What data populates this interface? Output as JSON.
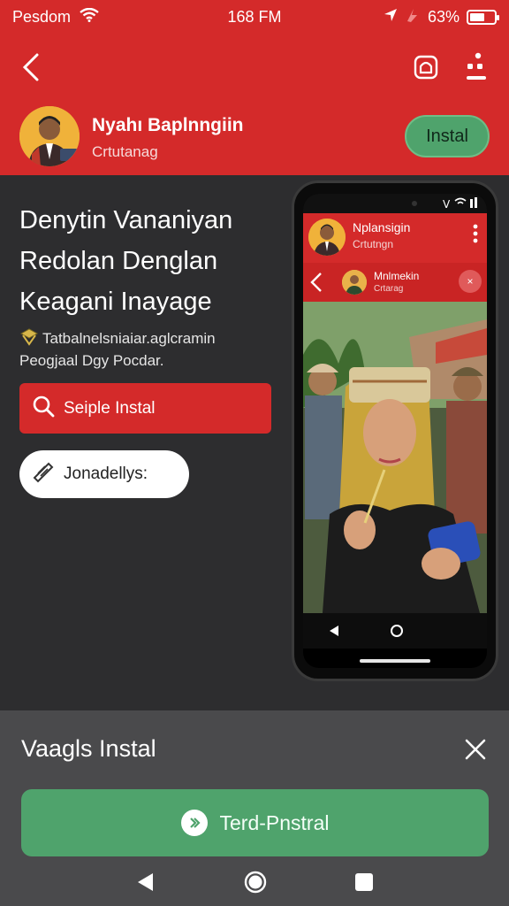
{
  "status_bar": {
    "carrier": "Pesdom",
    "time": "168 FM",
    "battery": "63%",
    "battery_level": 0.63
  },
  "header": {
    "app_name": "Nyahı Baplnngiin",
    "app_subtitle": "Crtutanag",
    "install_label": "Instal"
  },
  "headline": {
    "line1": "Denytin Vananiyan",
    "line2": "Redolan Denglan",
    "line3": "Keagani Inayage"
  },
  "promo": {
    "line1": "Tatbalnelsniaiar.aglcramin",
    "line2": "Peogjaal Dɡy Pocdar."
  },
  "search_button": {
    "label": "Seiple Instal"
  },
  "tag_button": {
    "label": "Jonadellys:"
  },
  "phone_preview": {
    "app_name": "Nplansigin",
    "app_subtitle": "Crtutngn",
    "chat_name": "Mnlmekin",
    "chat_subtitle": "Crtarag",
    "close_label": "×"
  },
  "sheet": {
    "title": "Vaagls Instal",
    "button_label": "Terd-Pnstral"
  },
  "colors": {
    "brand_red": "#d42a2a",
    "install_green": "#4fa36c",
    "background": "#2d2d2f",
    "sheet": "#4a4a4c"
  },
  "icons": [
    "wifi-icon",
    "location-icon",
    "signal-icon",
    "battery-icon",
    "back-icon",
    "share-icon",
    "more-icon",
    "search-icon",
    "pencil-icon",
    "close-icon",
    "arrow-icon",
    "nav-back-icon",
    "nav-home-icon",
    "nav-recents-icon"
  ]
}
